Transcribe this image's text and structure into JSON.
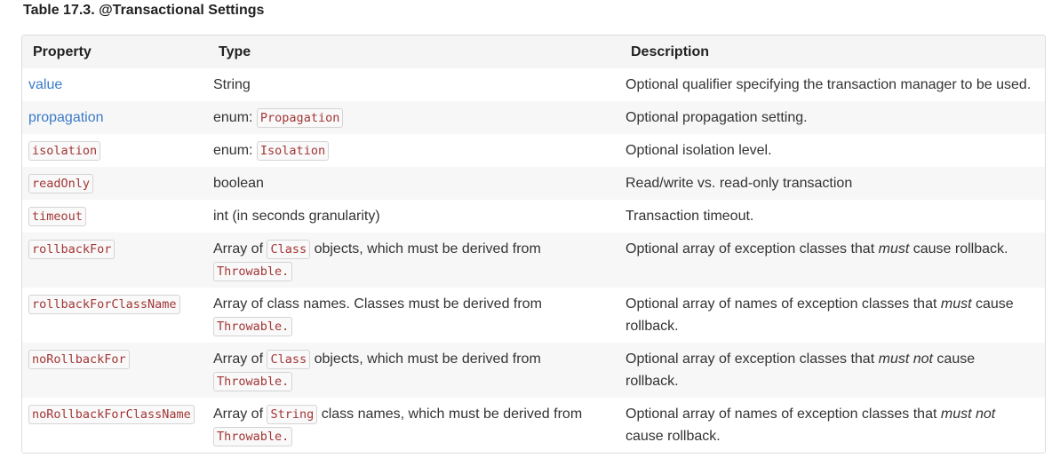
{
  "caption": "Table 17.3. @Transactional Settings",
  "headers": {
    "property": "Property",
    "type": "Type",
    "description": "Description"
  },
  "rows": [
    {
      "property": "value",
      "property_style": "link",
      "type_text": "String",
      "description": "Optional qualifier specifying the transaction manager to be used."
    },
    {
      "property": "propagation",
      "property_style": "link",
      "type_prefix": "enum:",
      "type_code": "Propagation",
      "description": "Optional propagation setting."
    },
    {
      "property": "isolation",
      "property_style": "code",
      "type_prefix": "enum:",
      "type_code": "Isolation",
      "description": "Optional isolation level."
    },
    {
      "property": "readOnly",
      "property_style": "code",
      "type_text": "boolean",
      "description": "Read/write vs. read-only transaction"
    },
    {
      "property": "timeout",
      "property_style": "code",
      "type_text": "int (in seconds granularity)",
      "description": "Transaction timeout."
    },
    {
      "property": "rollbackFor",
      "property_style": "code",
      "type_before": "Array of",
      "type_code": "Class",
      "type_after": "objects, which must be derived from",
      "type_code2": "Throwable.",
      "desc_before": "Optional array of exception classes that",
      "desc_em": "must",
      "desc_after": "cause rollback."
    },
    {
      "property": "rollbackForClassName",
      "property_style": "code",
      "type_before": "Array of class names. Classes must be derived from",
      "type_code2": "Throwable.",
      "desc_before": "Optional array of names of exception classes that",
      "desc_em": "must",
      "desc_after": "cause",
      "desc_line2": "rollback."
    },
    {
      "property": "noRollbackFor",
      "property_style": "code",
      "type_before": "Array of",
      "type_code": "Class",
      "type_after": "objects, which must be derived from",
      "type_code2": "Throwable.",
      "desc_before": "Optional array of exception classes that",
      "desc_em": "must not",
      "desc_after": "cause",
      "desc_line2": "rollback."
    },
    {
      "property": "noRollbackForClassName",
      "property_style": "code",
      "type_before": "Array of",
      "type_code": "String",
      "type_after": "class names, which must be derived from",
      "type_code2": "Throwable.",
      "desc_before": "Optional array of names of exception classes that",
      "desc_em": "must not",
      "desc_after": "",
      "desc_line2": "cause rollback."
    }
  ]
}
